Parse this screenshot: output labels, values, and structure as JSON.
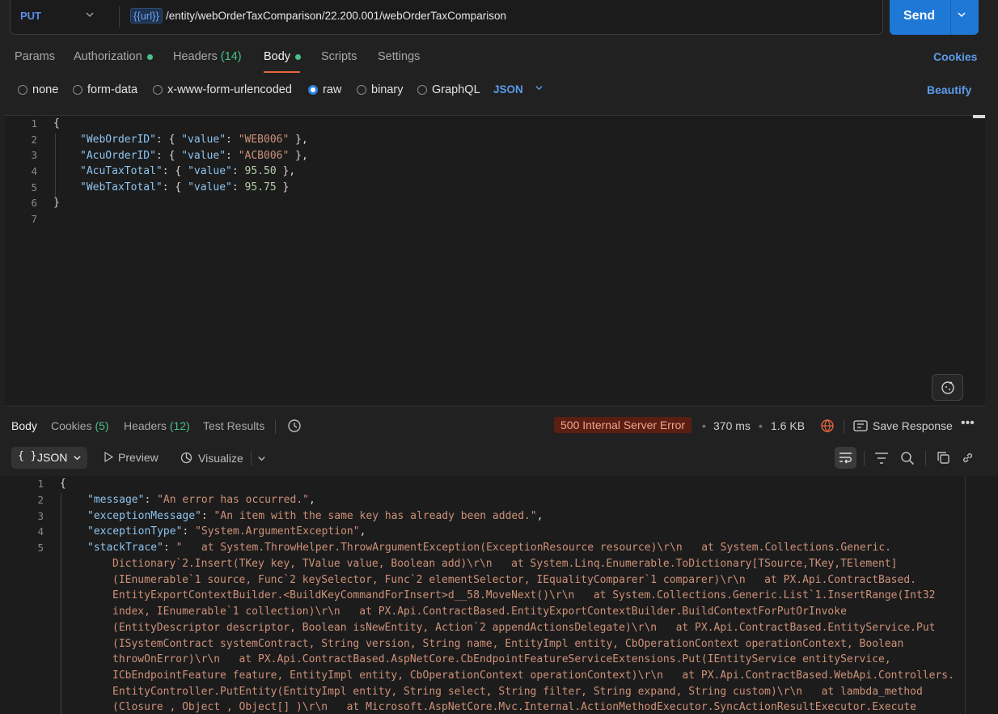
{
  "request": {
    "method": "PUT",
    "url_variable": "{{url}}",
    "url_path": "/entity/webOrderTaxComparison/22.200.001/webOrderTaxComparison",
    "send_label": "Send"
  },
  "request_tabs": [
    {
      "label": "Params"
    },
    {
      "label": "Authorization"
    },
    {
      "label": "Headers",
      "count": "(14)"
    },
    {
      "label": "Body"
    },
    {
      "label": "Scripts"
    },
    {
      "label": "Settings"
    }
  ],
  "cookies_link": "Cookies",
  "body_types": [
    "none",
    "form-data",
    "x-www-form-urlencoded",
    "raw",
    "binary",
    "GraphQL"
  ],
  "selected_body_type": "raw",
  "body_language": "JSON",
  "beautify_label": "Beautify",
  "request_body": {
    "line_numbers": [
      "1",
      "2",
      "3",
      "4",
      "5",
      "6",
      "7"
    ],
    "open_brace": "{",
    "close_brace": "}",
    "fields": [
      {
        "key": "\"WebOrderID\"",
        "mid": ": { ",
        "vkey": "\"value\"",
        "colon": ": ",
        "val": "\"WEB006\"",
        "end": " },",
        "kind": "s"
      },
      {
        "key": "\"AcuOrderID\"",
        "mid": ": { ",
        "vkey": "\"value\"",
        "colon": ": ",
        "val": "\"ACB006\"",
        "end": " },",
        "kind": "s"
      },
      {
        "key": "\"AcuTaxTotal\"",
        "mid": ": { ",
        "vkey": "\"value\"",
        "colon": ": ",
        "val": "95.50",
        "end": " },",
        "kind": "n"
      },
      {
        "key": "\"WebTaxTotal\"",
        "mid": ": { ",
        "vkey": "\"value\"",
        "colon": ": ",
        "val": "95.75",
        "end": " }",
        "kind": "n"
      }
    ]
  },
  "response_tabs": [
    {
      "label": "Body"
    },
    {
      "label": "Cookies",
      "count": "(5)"
    },
    {
      "label": "Headers",
      "count": "(12)"
    },
    {
      "label": "Test Results"
    }
  ],
  "response_status": "500 Internal Server Error",
  "response_time": "370 ms",
  "response_size": "1.6 KB",
  "save_response_label": "Save Response",
  "view_modes": {
    "json": "JSON",
    "preview": "Preview",
    "visualize": "Visualize"
  },
  "response_body": {
    "line_numbers": [
      "1",
      "2",
      "3",
      "4",
      "5"
    ],
    "open_brace": "{",
    "message_key": "\"message\"",
    "message_val": "\"An error has occurred.\"",
    "exmsg_key": "\"exceptionMessage\"",
    "exmsg_val": "\"An item with the same key has already been added.\"",
    "extype_key": "\"exceptionType\"",
    "extype_val": "\"System.ArgumentException\"",
    "stack_key": "\"stackTrace\"",
    "stack_lines": [
      "\"   at System.ThrowHelper.ThrowArgumentException(ExceptionResource resource)\\r\\n   at System.Collections.Generic.",
      "Dictionary`2.Insert(TKey key, TValue value, Boolean add)\\r\\n   at System.Linq.Enumerable.ToDictionary[TSource,TKey,TElement]",
      "(IEnumerable`1 source, Func`2 keySelector, Func`2 elementSelector, IEqualityComparer`1 comparer)\\r\\n   at PX.Api.ContractBased.",
      "EntityExportContextBuilder.<BuildKeyCommandForInsert>d__58.MoveNext()\\r\\n   at System.Collections.Generic.List`1.InsertRange(Int32",
      "index, IEnumerable`1 collection)\\r\\n   at PX.Api.ContractBased.EntityExportContextBuilder.BuildContextForPutOrInvoke",
      "(EntityDescriptor descriptor, Boolean isNewEntity, Action`2 appendActionsDelegate)\\r\\n   at PX.Api.ContractBased.EntityService.Put",
      "(ISystemContract systemContract, String version, String name, EntityImpl entity, CbOperationContext operationContext, Boolean",
      "throwOnError)\\r\\n   at PX.Api.ContractBased.AspNetCore.CbEndpointFeatureServiceExtensions.Put(IEntityService entityService,",
      "ICbEndpointFeature feature, EntityImpl entity, CbOperationContext operationContext)\\r\\n   at PX.Api.ContractBased.WebApi.Controllers.",
      "EntityController.PutEntity(EntityImpl entity, String select, String filter, String expand, String custom)\\r\\n   at lambda_method",
      "(Closure , Object , Object[] )\\r\\n   at Microsoft.AspNetCore.Mvc.Internal.ActionMethodExecutor.SyncActionResultExecutor.Execute"
    ]
  },
  "colors": {
    "accent": "#1f78d6",
    "active_tab": "#e8643c",
    "success": "#48c08b",
    "error_badge": "#5a1f12"
  }
}
